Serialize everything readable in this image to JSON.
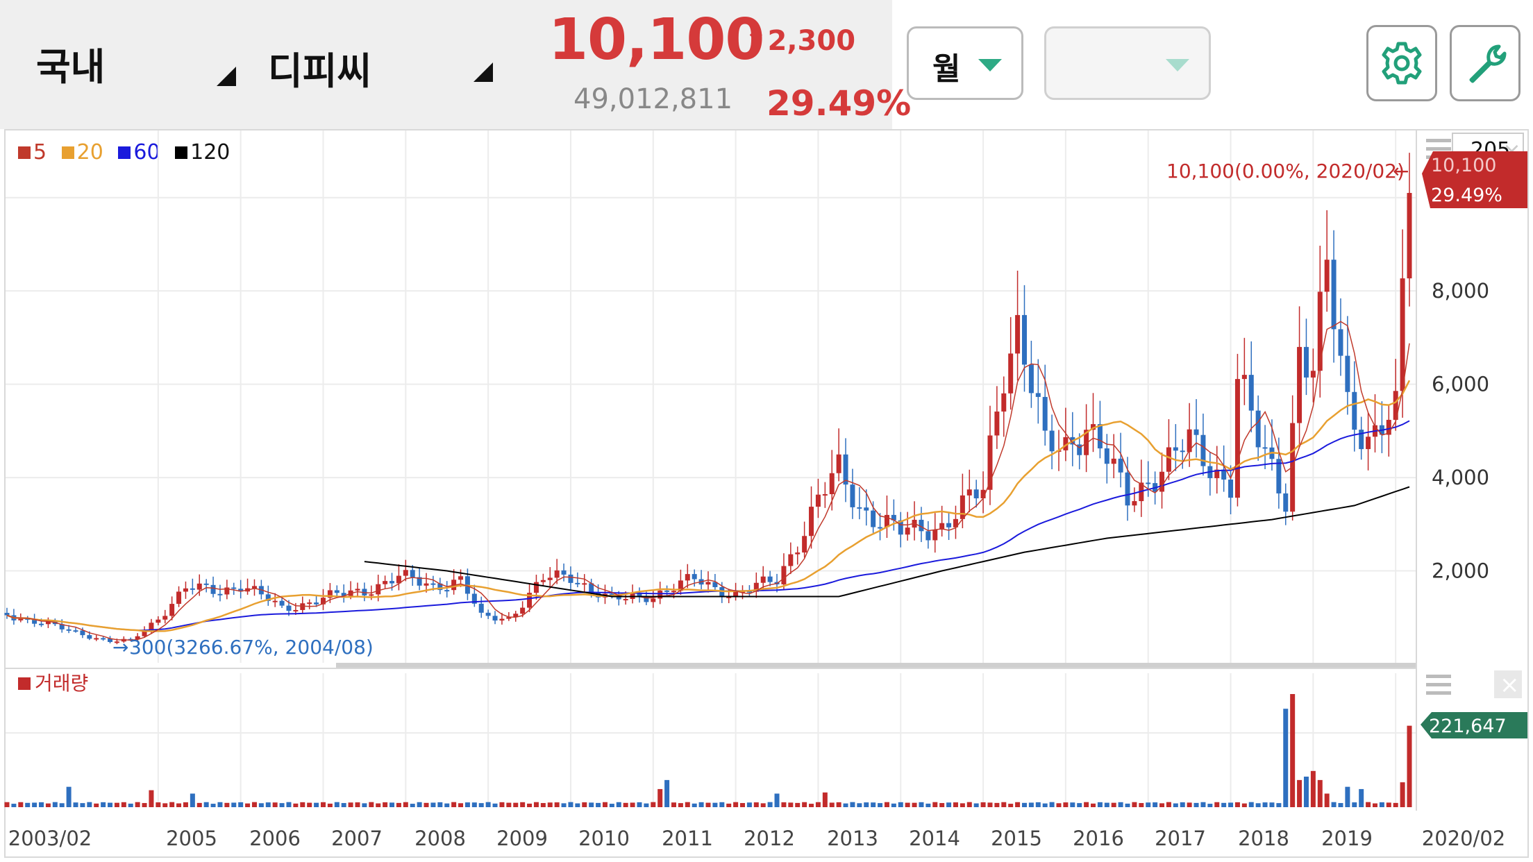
{
  "header": {
    "market": "국내",
    "stock": "디피씨",
    "price": "10,100",
    "change": "2,300",
    "volume": "49,012,811",
    "change_pct": "29.49%",
    "period": "월",
    "secondary": ""
  },
  "chart_data": {
    "type": "candlestick",
    "period": "monthly",
    "legend": [
      {
        "name": "5",
        "color": "#c0392b"
      },
      {
        "name": "20",
        "color": "#e8a030"
      },
      {
        "name": "60",
        "color": "#1a1adc"
      },
      {
        "name": "120",
        "color": "#000000"
      }
    ],
    "x_ticks": [
      "2003/02",
      "2005",
      "2006",
      "2007",
      "2008",
      "2009",
      "2010",
      "2011",
      "2012",
      "2013",
      "2014",
      "2015",
      "2016",
      "2017",
      "2018",
      "2019",
      "2020/02"
    ],
    "y_ticks": [
      "2,000",
      "4,000",
      "6,000",
      "8,000"
    ],
    "ylim": [
      0,
      10100
    ],
    "close_anchor": [
      [
        "2003-02",
        1100
      ],
      [
        "2003-06",
        900
      ],
      [
        "2003-12",
        700
      ],
      [
        "2004-05",
        480
      ],
      [
        "2004-08",
        500
      ],
      [
        "2004-12",
        1000
      ],
      [
        "2005-04",
        1600
      ],
      [
        "2005-09",
        1600
      ],
      [
        "2005-12",
        1700
      ],
      [
        "2006-06",
        1200
      ],
      [
        "2006-12",
        1400
      ],
      [
        "2007-06",
        1600
      ],
      [
        "2007-11",
        1850
      ],
      [
        "2008-04",
        1700
      ],
      [
        "2008-08",
        1800
      ],
      [
        "2008-11",
        1000
      ],
      [
        "2009-03",
        1000
      ],
      [
        "2009-08",
        1800
      ],
      [
        "2009-12",
        1900
      ],
      [
        "2010-06",
        1350
      ],
      [
        "2010-12",
        1500
      ],
      [
        "2011-06",
        1800
      ],
      [
        "2011-12",
        1500
      ],
      [
        "2012-06",
        1800
      ],
      [
        "2012-12",
        3500
      ],
      [
        "2013-03",
        4100
      ],
      [
        "2013-06",
        3400
      ],
      [
        "2013-12",
        2800
      ],
      [
        "2014-06",
        3000
      ],
      [
        "2014-12",
        3700
      ],
      [
        "2015-03",
        6500
      ],
      [
        "2015-05",
        7300
      ],
      [
        "2015-09",
        4600
      ],
      [
        "2015-12",
        4700
      ],
      [
        "2016-03",
        5200
      ],
      [
        "2016-09",
        3500
      ],
      [
        "2016-12",
        4000
      ],
      [
        "2017-06",
        4700
      ],
      [
        "2017-12",
        3900
      ],
      [
        "2018-01",
        6200
      ],
      [
        "2018-04",
        4700
      ],
      [
        "2018-08",
        3600
      ],
      [
        "2018-10",
        6800
      ],
      [
        "2018-12",
        6300
      ],
      [
        "2019-02",
        8200
      ],
      [
        "2019-05",
        5600
      ],
      [
        "2019-08",
        4900
      ],
      [
        "2019-12",
        5300
      ],
      [
        "2020-01",
        7800
      ],
      [
        "2020-02",
        10100
      ]
    ],
    "ma120_anchor": [
      [
        "2007-06",
        2200
      ],
      [
        "2008-06",
        2000
      ],
      [
        "2010-06",
        1450
      ],
      [
        "2012-06",
        1450
      ],
      [
        "2013-03",
        1450
      ],
      [
        "2014-06",
        2000
      ],
      [
        "2015-06",
        2400
      ],
      [
        "2016-06",
        2700
      ],
      [
        "2017-06",
        2900
      ],
      [
        "2018-06",
        3100
      ],
      [
        "2019-06",
        3400
      ],
      [
        "2020-02",
        3800
      ]
    ],
    "annotations": {
      "high_label": "10,100(0.00%, 2020/02)",
      "low_label": "300(3266.67%, 2004/08)",
      "price_badge": "10,100",
      "pct_badge": "29.49%",
      "corner_num": "205"
    },
    "volume_panel": {
      "label": "거래량",
      "last_value": "221,647",
      "peaks": [
        [
          "2003-11",
          0.18
        ],
        [
          "2004-11",
          0.15
        ],
        [
          "2005-05",
          0.12
        ],
        [
          "2011-01",
          0.16
        ],
        [
          "2011-02",
          0.24
        ],
        [
          "2012-06",
          0.12
        ],
        [
          "2013-01",
          0.13
        ],
        [
          "2018-08",
          0.87
        ],
        [
          "2018-09",
          1.0
        ],
        [
          "2018-10",
          0.24
        ],
        [
          "2018-11",
          0.27
        ],
        [
          "2018-12",
          0.32
        ],
        [
          "2019-01",
          0.24
        ],
        [
          "2019-02",
          0.12
        ],
        [
          "2019-05",
          0.18
        ],
        [
          "2019-07",
          0.16
        ],
        [
          "2020-01",
          0.22
        ],
        [
          "2020-02",
          0.72
        ]
      ]
    }
  }
}
